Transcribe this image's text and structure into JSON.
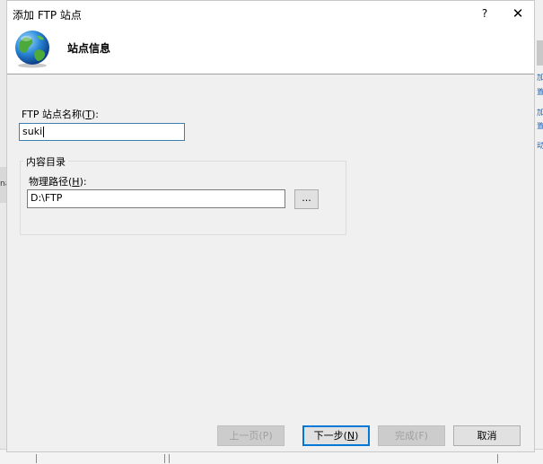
{
  "dialog": {
    "title": "添加 FTP 站点",
    "help_label": "?",
    "close_label": "✕"
  },
  "banner": {
    "title": "站点信息",
    "icon": "globe-icon"
  },
  "site_name": {
    "label_pre": "FTP 站点名称(",
    "label_key": "T",
    "label_post": "):",
    "value": "suki"
  },
  "content_dir": {
    "group_title": "内容目录",
    "path_label_pre": "物理路径(",
    "path_label_key": "H",
    "path_label_post": "):",
    "path_value": "D:\\FTP",
    "browse_label": "..."
  },
  "buttons": {
    "prev": "上一页(P)",
    "next_pre": "下一步(",
    "next_key": "N",
    "next_post": ")",
    "finish": "完成(F)",
    "cancel": "取消"
  },
  "colors": {
    "accent": "#0078d7",
    "focus_border": "#3c7fb1"
  },
  "background": {
    "right_edge_chars": [
      "加",
      "置",
      "加",
      "置",
      "动"
    ],
    "left_edge_text": "na"
  }
}
